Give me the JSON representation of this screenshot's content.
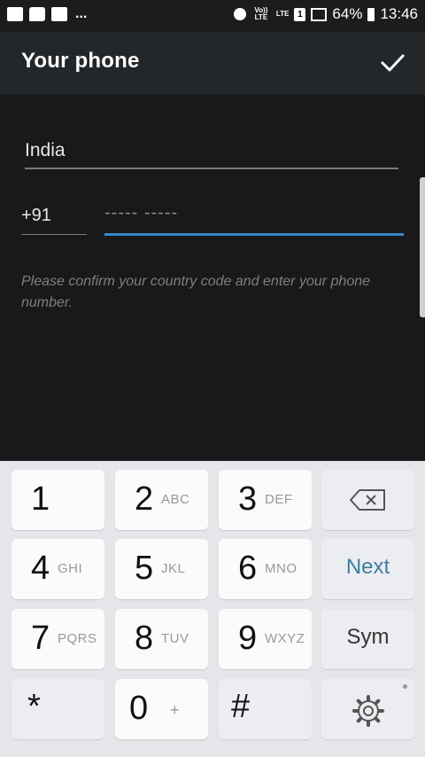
{
  "status_bar": {
    "more": "...",
    "volte": "Vo)) LTE",
    "lte": "LTE",
    "sim": "1",
    "battery_percent": "64%",
    "time": "13:46"
  },
  "appbar": {
    "title": "Your phone",
    "confirm_icon": "check-icon"
  },
  "form": {
    "country": "India",
    "country_code": "+91",
    "phone_placeholder": "----- -----",
    "hint": "Please confirm your country code and enter your phone number."
  },
  "keyboard": {
    "keys": [
      {
        "num": "1",
        "letters": ""
      },
      {
        "num": "2",
        "letters": "ABC"
      },
      {
        "num": "3",
        "letters": "DEF"
      },
      {
        "num": "4",
        "letters": "GHI"
      },
      {
        "num": "5",
        "letters": "JKL"
      },
      {
        "num": "6",
        "letters": "MNO"
      },
      {
        "num": "7",
        "letters": "PQRS"
      },
      {
        "num": "8",
        "letters": "TUV"
      },
      {
        "num": "9",
        "letters": "WXYZ"
      },
      {
        "num": "*",
        "letters": ""
      },
      {
        "num": "0",
        "letters": "+"
      },
      {
        "num": "#",
        "letters": ""
      }
    ],
    "next_label": "Next",
    "sym_label": "Sym",
    "backspace_icon": "backspace-icon",
    "settings_icon": "gear-icon"
  },
  "colors": {
    "accent": "#3a87c4",
    "appbar": "#24272a",
    "background": "#19191b",
    "keyboard": "#e4e6e9"
  }
}
